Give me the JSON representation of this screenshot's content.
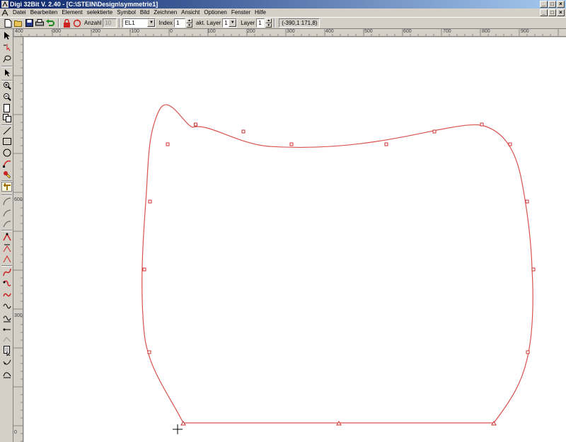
{
  "window": {
    "title": "Digi 32Bit  V. 2.40 - [C:\\STEIN\\Design\\symmetrie1]",
    "buttons": [
      "_",
      "□",
      "×"
    ],
    "doc_buttons": [
      "_",
      "□",
      "×"
    ]
  },
  "menu": {
    "items": [
      "Datei",
      "Bearbeiten",
      "Element",
      "selektierte",
      "Symbol",
      "Bild",
      "Zeichnen",
      "Ansicht",
      "Optionen",
      "Fenster",
      "Hilfe"
    ]
  },
  "toolbar": {
    "anzahl_label": "Anzahl",
    "anzahl_value": "10",
    "element_value": "EL1",
    "index_label": "Index",
    "index_value": "1",
    "akt_layer_label": "akt. Layer",
    "akt_layer_value": "1",
    "layer_label": "Layer",
    "layer_value": "1",
    "coordinates": "(-390,1 171,8)"
  },
  "ruler_top": {
    "labels": [
      "400",
      "-300",
      "-200",
      "-100",
      "0",
      "100",
      "200",
      "300",
      "400",
      "500",
      "600",
      "700",
      "800",
      "900"
    ]
  },
  "ruler_left": {
    "labels": [
      "600",
      "300",
      "0"
    ]
  },
  "left_tools": [
    "select-arrow",
    "node-select",
    "lasso",
    "pointer",
    "zoom-in",
    "zoom-out",
    "page",
    "copy-page",
    "line",
    "rectangle",
    "circle",
    "bezier-node",
    "color-fill",
    "measure",
    "arc",
    "curve-a",
    "curve-b",
    "triangle-a",
    "triangle-b",
    "triangle-c",
    "spiral-a",
    "spiral-b",
    "spiral-c",
    "wave-a",
    "wave-b",
    "dot-line",
    "star-line",
    "document",
    "hook-a",
    "hook-b"
  ],
  "colors": {
    "shape_stroke": "#d9534f",
    "node_color": "#cc3333",
    "title_start": "#0a246a",
    "title_end": "#a6caf0"
  }
}
